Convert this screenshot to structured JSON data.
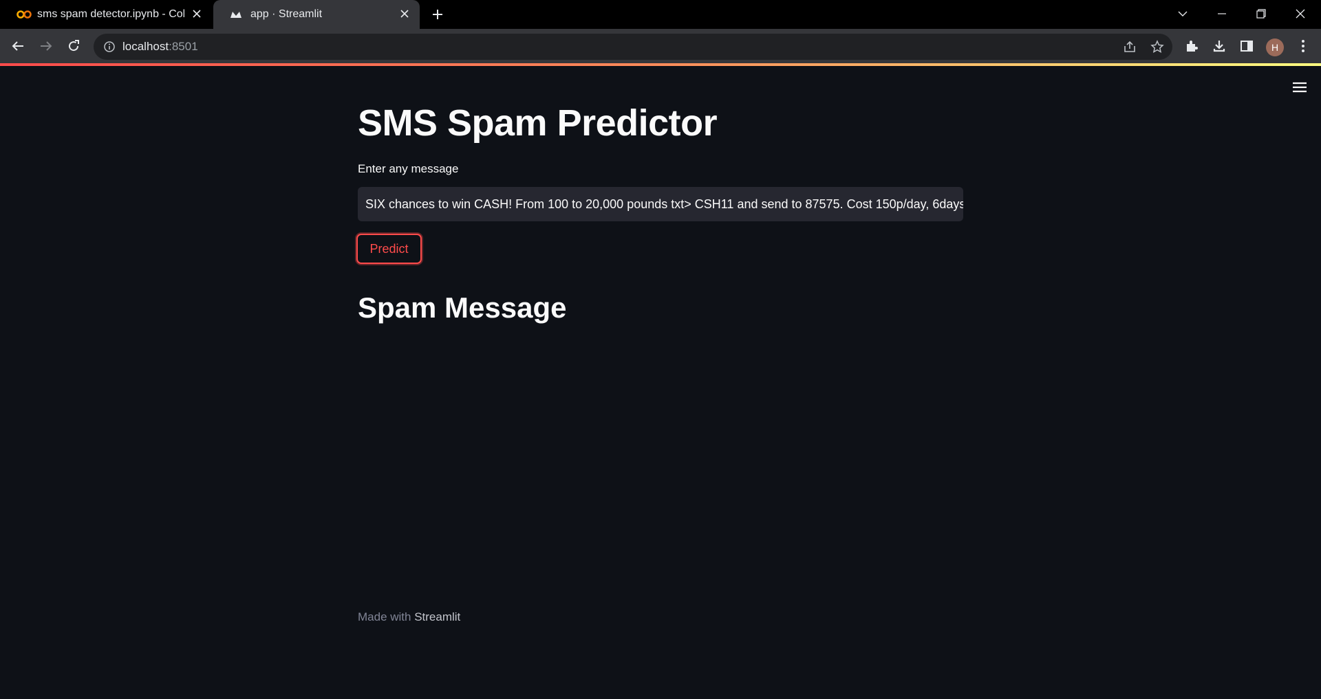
{
  "browser": {
    "tabs": [
      {
        "title": "sms spam detector.ipynb - Colab",
        "favicon": "colab-icon",
        "active": false
      },
      {
        "title": "app · Streamlit",
        "favicon": "streamlit-icon",
        "active": true
      }
    ],
    "address": {
      "host": "localhost",
      "port": ":8501"
    },
    "profile_initial": "H"
  },
  "app": {
    "title": "SMS Spam Predictor",
    "input_label": "Enter any message",
    "input_value": "SIX chances to win CASH! From 100 to 20,000 pounds txt> CSH11 and send to 87575. Cost 150p/day, 6days",
    "predict_label": "Predict",
    "result": "Spam Message"
  },
  "footer": {
    "prefix": "Made with ",
    "brand": "Streamlit"
  },
  "colors": {
    "background": "#0e1117",
    "accent": "#ff4b4b",
    "input_bg": "#262730",
    "text": "#fafafa"
  }
}
